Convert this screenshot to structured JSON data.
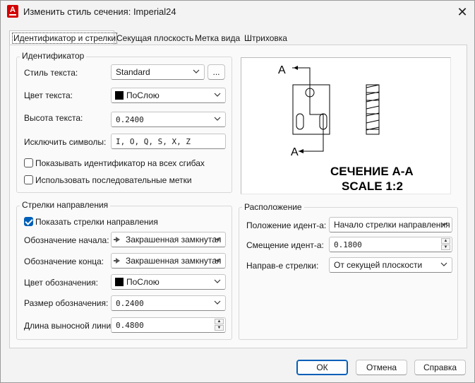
{
  "window": {
    "title": "Изменить стиль сечения: Imperial24",
    "app_icon": "autocad-a-icon",
    "app_icon_letter": "A",
    "close_glyph": "✕"
  },
  "tabs": [
    {
      "label": "Идентификатор и стрелки",
      "active": true
    },
    {
      "label": "Секущая плоскость",
      "active": false
    },
    {
      "label": "Метка вида",
      "active": false
    },
    {
      "label": "Штриховка",
      "active": false
    }
  ],
  "identifier": {
    "group_title": "Идентификатор",
    "text_style_label": "Стиль текста:",
    "text_style_value": "Standard",
    "browse_label": "...",
    "text_color_label": "Цвет текста:",
    "text_color_value": "ПоСлою",
    "text_height_label": "Высота текста:",
    "text_height_value": "0.2400",
    "exclude_label": "Исключить символы:",
    "exclude_value": "I, O, Q, S, X, Z",
    "show_all_bends_label": "Показывать идентификатор на всех сгибах",
    "show_all_bends_checked": false,
    "consecutive_label": "Использовать последовательные метки",
    "consecutive_checked": false
  },
  "arrows": {
    "group_title": "Стрелки направления",
    "show_arrows_label": "Показать стрелки направления",
    "show_arrows_checked": true,
    "start_label": "Обозначение начала:",
    "start_value": "Закрашенная замкнутая",
    "end_label": "Обозначение конца:",
    "end_value": "Закрашенная замкнутая",
    "color_label": "Цвет обозначения:",
    "color_value": "ПоСлою",
    "size_label": "Размер обозначения:",
    "size_value": "0.2400",
    "ext_len_label": "Длина выносной линии:",
    "ext_len_value": "0.4800"
  },
  "location": {
    "group_title": "Расположение",
    "id_pos_label": "Положение идент-а:",
    "id_pos_value": "Начало стрелки направления",
    "id_offset_label": "Смещение идент-а:",
    "id_offset_value": "0.1800",
    "arrow_dir_label": "Направ-е стрелки:",
    "arrow_dir_value": "От секущей плоскости"
  },
  "preview": {
    "label_a_top": "A",
    "label_a_bottom": "A",
    "caption_line1": "СЕЧЕНИЕ А-А",
    "caption_line2": "SCALE 1:2"
  },
  "buttons": {
    "ok": "ОК",
    "cancel": "Отмена",
    "help": "Справка"
  },
  "colors": {
    "accent": "#005fb8",
    "swatch": "#000000",
    "app_icon": "#d40000"
  }
}
